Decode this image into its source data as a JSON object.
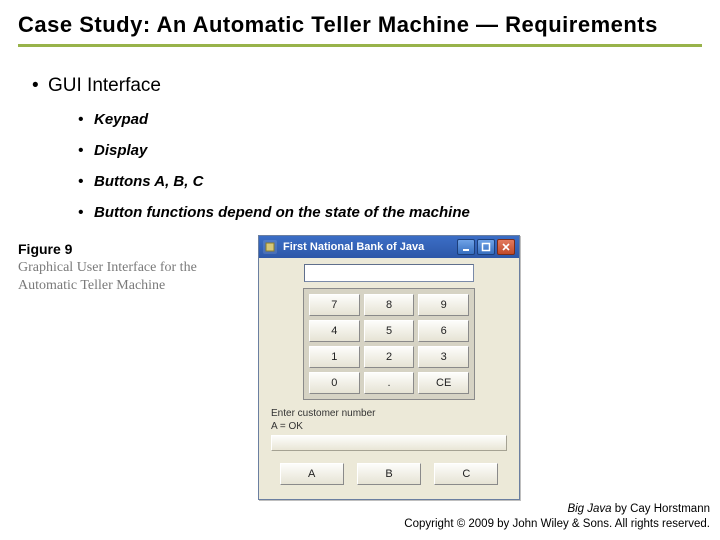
{
  "title": "Case Study: An Automatic Teller Machine — Requirements",
  "bullets1": [
    {
      "label": "GUI Interface"
    }
  ],
  "bullets2": [
    "Keypad",
    "Display",
    "Buttons A, B, C",
    "Button functions depend on the state of the machine"
  ],
  "figure": {
    "label": "Figure 9",
    "caption": "Graphical User Interface for the Automatic Teller Machine"
  },
  "window": {
    "title": "First National Bank of Java",
    "min_tip": "Minimize",
    "max_tip": "Maximize",
    "close_tip": "Close",
    "keypad": [
      [
        "7",
        "8",
        "9"
      ],
      [
        "4",
        "5",
        "6"
      ],
      [
        "1",
        "2",
        "3"
      ],
      [
        "0",
        ".",
        "CE"
      ]
    ],
    "prompt_line1": "Enter customer number",
    "prompt_line2": "A = OK",
    "abc": [
      "A",
      "B",
      "C"
    ]
  },
  "footer": {
    "line1_prefix": "Big Java",
    "line1_suffix": " by Cay Horstmann",
    "line2": "Copyright © 2009 by John Wiley & Sons. All rights reserved."
  }
}
